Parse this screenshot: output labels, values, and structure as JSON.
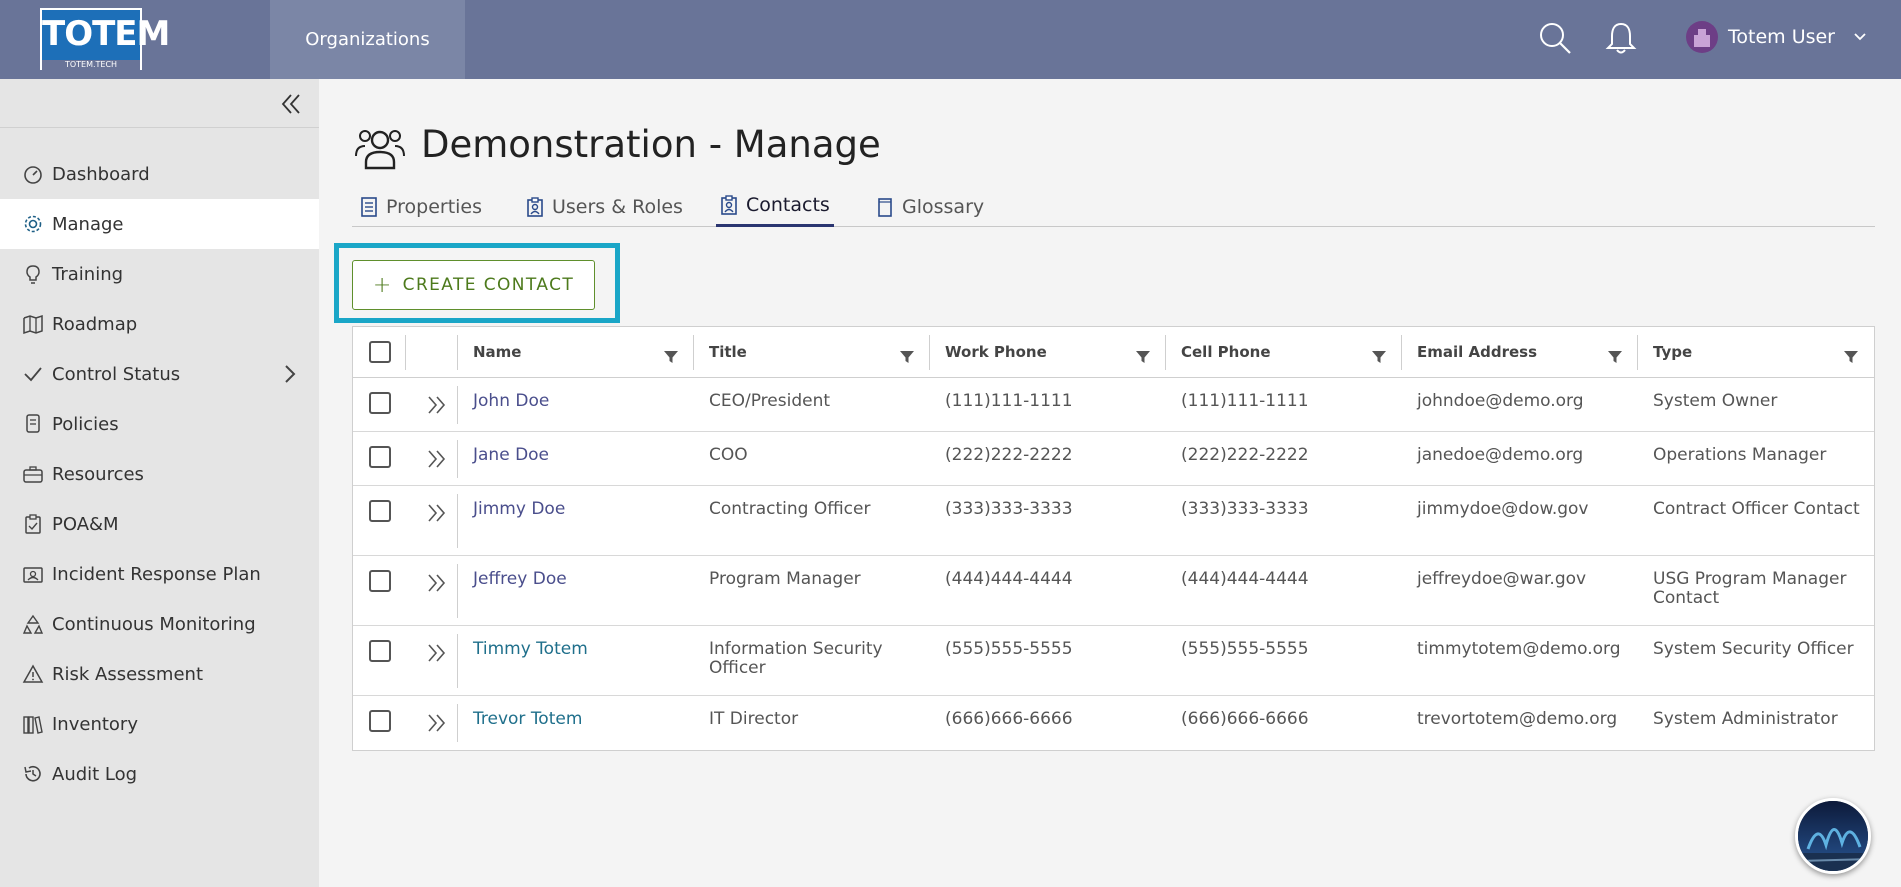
{
  "header": {
    "logo_text": "TOTEM",
    "logo_subtext": "TOTEM.TECH",
    "org_tab": "Organizations",
    "user_name": "Totem User"
  },
  "sidebar": {
    "items": [
      {
        "label": "Dashboard",
        "icon": "gauge-icon"
      },
      {
        "label": "Manage",
        "icon": "gear-icon",
        "active": true
      },
      {
        "label": "Training",
        "icon": "lightbulb-icon"
      },
      {
        "label": "Roadmap",
        "icon": "map-icon"
      },
      {
        "label": "Control Status",
        "icon": "check-icon",
        "has_children": true
      },
      {
        "label": "Policies",
        "icon": "scroll-icon"
      },
      {
        "label": "Resources",
        "icon": "toolbox-icon"
      },
      {
        "label": "POA&M",
        "icon": "clipboard-icon"
      },
      {
        "label": "Incident Response Plan",
        "icon": "id-card-icon"
      },
      {
        "label": "Continuous Monitoring",
        "icon": "recycle-icon"
      },
      {
        "label": "Risk Assessment",
        "icon": "warning-icon"
      },
      {
        "label": "Inventory",
        "icon": "books-icon"
      },
      {
        "label": "Audit Log",
        "icon": "history-icon"
      }
    ]
  },
  "page": {
    "title": "Demonstration - Manage",
    "tabs": [
      {
        "label": "Properties"
      },
      {
        "label": "Users & Roles"
      },
      {
        "label": "Contacts",
        "active": true
      },
      {
        "label": "Glossary"
      }
    ],
    "create_button": "CREATE CONTACT"
  },
  "table": {
    "columns": [
      "Name",
      "Title",
      "Work Phone",
      "Cell Phone",
      "Email Address",
      "Type"
    ],
    "rows": [
      {
        "name": "John Doe",
        "title": "CEO/President",
        "work": "(111)111-1111",
        "cell": "(111)111-1111",
        "email": "johndoe@demo.org",
        "type": "System Owner"
      },
      {
        "name": "Jane Doe",
        "title": "COO",
        "work": "(222)222-2222",
        "cell": "(222)222-2222",
        "email": "janedoe@demo.org",
        "type": "Operations Manager"
      },
      {
        "name": "Jimmy Doe",
        "title": "Contracting Officer",
        "work": "(333)333-3333",
        "cell": "(333)333-3333",
        "email": "jimmydoe@dow.gov",
        "type": "Contract Officer Contact"
      },
      {
        "name": "Jeffrey Doe",
        "title": "Program Manager",
        "work": "(444)444-4444",
        "cell": "(444)444-4444",
        "email": "jeffreydoe@war.gov",
        "type": "USG Program Manager Contact"
      },
      {
        "name": "Timmy Totem",
        "title": "Information Security Officer",
        "work": "(555)555-5555",
        "cell": "(555)555-5555",
        "email": "timmytotem@demo.org",
        "type": "System Security Officer"
      },
      {
        "name": "Trevor Totem",
        "title": "IT Director",
        "work": "(666)666-6666",
        "cell": "(666)666-6666",
        "email": "trevortotem@demo.org",
        "type": "System Administrator"
      }
    ]
  },
  "colors": {
    "topbar": "#697498",
    "highlight": "#1aa6c7",
    "create_button": "#4d7a1c"
  }
}
